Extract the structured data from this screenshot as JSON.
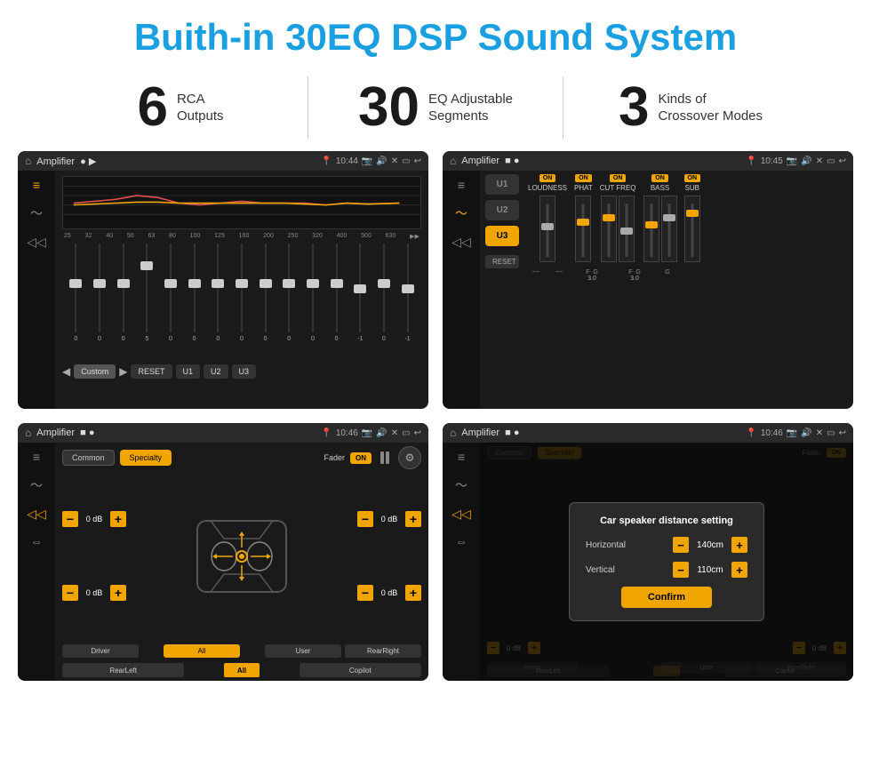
{
  "header": {
    "title": "Buith-in 30EQ DSP Sound System"
  },
  "stats": [
    {
      "number": "6",
      "label": "RCA\nOutputs"
    },
    {
      "number": "30",
      "label": "EQ Adjustable\nSegments"
    },
    {
      "number": "3",
      "label": "Kinds of\nCrossover Modes"
    }
  ],
  "screens": [
    {
      "id": "eq-screen",
      "status_bar": {
        "title": "Amplifier",
        "time": "10:44"
      },
      "eq_freqs": [
        "25",
        "32",
        "40",
        "50",
        "63",
        "80",
        "100",
        "125",
        "160",
        "200",
        "250",
        "320",
        "400",
        "500",
        "630"
      ],
      "eq_values": [
        "0",
        "0",
        "0",
        "5",
        "0",
        "0",
        "0",
        "0",
        "0",
        "0",
        "0",
        "0",
        "-1",
        "0",
        "-1"
      ],
      "preset": "Custom"
    },
    {
      "id": "crossover-screen",
      "status_bar": {
        "title": "Amplifier",
        "time": "10:45"
      },
      "channels": [
        {
          "label": "LOUDNESS",
          "on": true
        },
        {
          "label": "PHAT",
          "on": true
        },
        {
          "label": "CUT FREQ",
          "on": true
        },
        {
          "label": "BASS",
          "on": true
        },
        {
          "label": "SUB",
          "on": true
        }
      ],
      "u_buttons": [
        "U1",
        "U2",
        "U3"
      ]
    },
    {
      "id": "fader-screen",
      "status_bar": {
        "title": "Amplifier",
        "time": "10:46"
      },
      "tabs": [
        "Common",
        "Specialty"
      ],
      "fader_label": "Fader",
      "fader_on": true,
      "speaker_vals": {
        "fl": "0 dB",
        "fr": "0 dB",
        "rl": "0 dB",
        "rr": "0 dB"
      },
      "bottom_btns": [
        "Driver",
        "",
        "All",
        "",
        "User",
        "RearRight",
        "RearLeft",
        "Copilot"
      ]
    },
    {
      "id": "dialog-screen",
      "status_bar": {
        "title": "Amplifier",
        "time": "10:46"
      },
      "dialog": {
        "title": "Car speaker distance setting",
        "horizontal_label": "Horizontal",
        "horizontal_val": "140cm",
        "vertical_label": "Vertical",
        "vertical_val": "110cm",
        "confirm_label": "Confirm"
      }
    }
  ]
}
